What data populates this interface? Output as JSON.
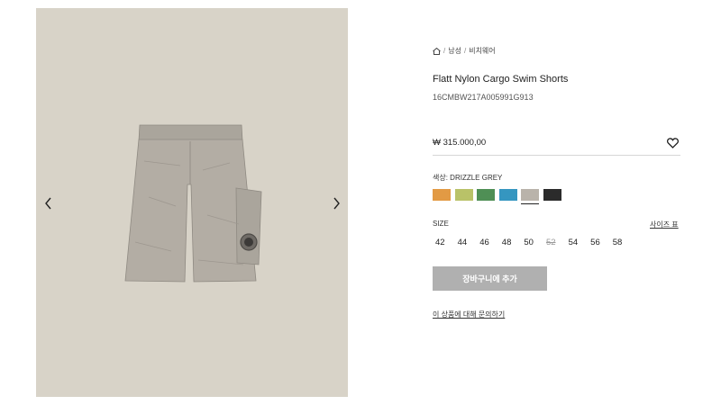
{
  "breadcrumb": {
    "home_icon": "home-icon",
    "items": [
      "남성",
      "비치웨어"
    ]
  },
  "product": {
    "title": "Flatt Nylon Cargo Swim Shorts",
    "sku": "16CMBW217A005991G913",
    "price": "₩ 315.000,00"
  },
  "gallery": {
    "background": "#d8d3c8",
    "prev_icon": "chevron-left-icon",
    "next_icon": "chevron-right-icon"
  },
  "wishlist": {
    "icon": "heart-icon"
  },
  "color": {
    "label": "색상: DRIZZLE GREY",
    "swatches": [
      {
        "color": "#e29a44"
      },
      {
        "color": "#b9c268"
      },
      {
        "color": "#4f8f55"
      },
      {
        "color": "#3596c0"
      },
      {
        "color": "#b9b3aa",
        "selected": true
      },
      {
        "color": "#2b2b2b"
      }
    ]
  },
  "size": {
    "label": "SIZE",
    "guide": "사이즈 표",
    "options": [
      {
        "value": "42",
        "available": true
      },
      {
        "value": "44",
        "available": true
      },
      {
        "value": "46",
        "available": true
      },
      {
        "value": "48",
        "available": true
      },
      {
        "value": "50",
        "available": true
      },
      {
        "value": "52",
        "available": false
      },
      {
        "value": "54",
        "available": true
      },
      {
        "value": "56",
        "available": true
      },
      {
        "value": "58",
        "available": true
      }
    ]
  },
  "cta": {
    "add_to_cart": "장바구니에 추가",
    "inquiry": "이 상품에 대해 문의하기"
  }
}
